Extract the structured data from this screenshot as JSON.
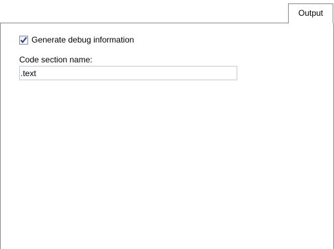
{
  "tabs": [
    {
      "label": "Output",
      "selected": true
    }
  ],
  "output_page": {
    "debug_checkbox": {
      "label": "Generate debug information",
      "checked": true
    },
    "code_section": {
      "label": "Code section name:",
      "value": ".text"
    }
  },
  "colors": {
    "border": "#898c95",
    "check_mark": "#2a3f8a",
    "input_border": "#c5cad4"
  }
}
